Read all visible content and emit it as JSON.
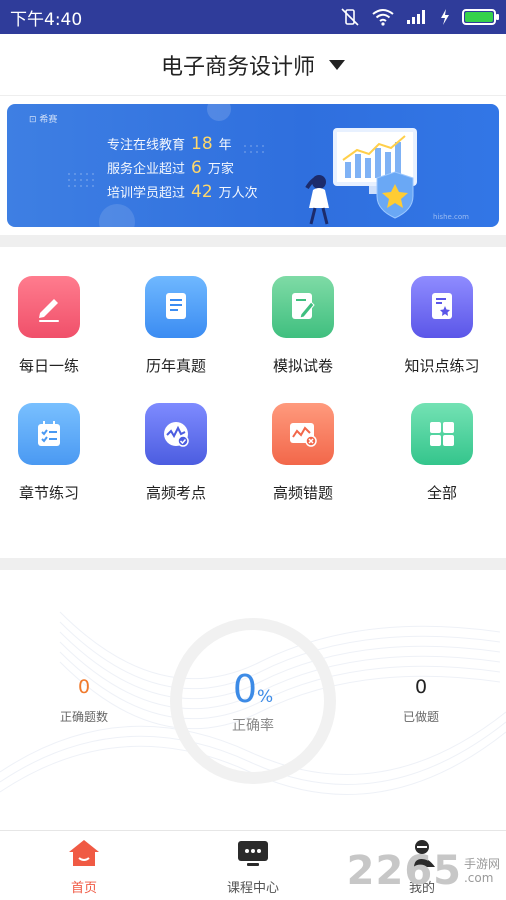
{
  "status_bar": {
    "time": "下午4:40",
    "battery_level": 1.0
  },
  "header": {
    "title": "电子商务设计师"
  },
  "banner": {
    "tag": "⊡ 希赛",
    "lines": [
      {
        "prefix": "专注在线教育",
        "number": "18",
        "suffix": "年"
      },
      {
        "prefix": "服务企业超过",
        "number": "6",
        "suffix": "万家"
      },
      {
        "prefix": "培训学员超过",
        "number": "42",
        "suffix": "万人次"
      }
    ],
    "corner_text": "hishe.com"
  },
  "features": [
    {
      "label": "每日一练",
      "icon": "pencil-icon"
    },
    {
      "label": "历年真题",
      "icon": "document-icon"
    },
    {
      "label": "模拟试卷",
      "icon": "edit-paper-icon"
    },
    {
      "label": "知识点练习",
      "icon": "bookmark-star-icon"
    },
    {
      "label": "章节练习",
      "icon": "checklist-icon"
    },
    {
      "label": "高频考点",
      "icon": "wave-check-icon"
    },
    {
      "label": "高频错题",
      "icon": "chart-error-icon"
    },
    {
      "label": "全部",
      "icon": "grid-icon"
    }
  ],
  "stats": {
    "correct_count": {
      "value": "0",
      "label": "正确题数"
    },
    "accuracy": {
      "value": "0",
      "unit": "%",
      "label": "正确率"
    },
    "done_count": {
      "value": "0",
      "label": "已做题"
    }
  },
  "tabs": [
    {
      "label": "首页",
      "icon": "home-icon",
      "active": true
    },
    {
      "label": "课程中心",
      "icon": "tv-icon",
      "active": false
    },
    {
      "label": "我的",
      "icon": "user-icon",
      "active": false
    }
  ],
  "watermark": {
    "text": "2265",
    "domain": ".com",
    "name": "手游网"
  },
  "colors": {
    "status_bar": "#2f3c9a",
    "accent": "#3d8be6",
    "stat_orange": "#f07a2d",
    "tab_active": "#f05a44"
  }
}
